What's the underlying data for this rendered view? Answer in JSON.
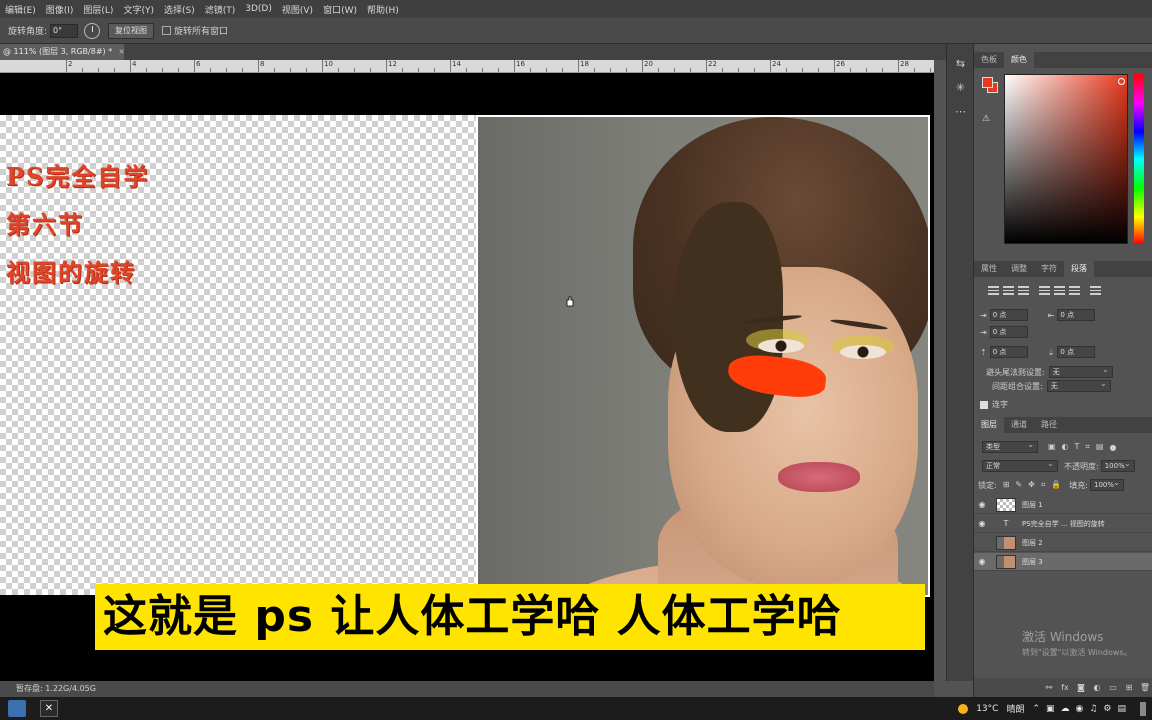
{
  "menu": [
    "编辑(E)",
    "图像(I)",
    "图层(L)",
    "文字(Y)",
    "选择(S)",
    "滤镜(T)",
    "3D(D)",
    "视图(V)",
    "窗口(W)",
    "帮助(H)"
  ],
  "options": {
    "rotate_label": "旋转角度:",
    "rotate_value": "0°",
    "reset_view": "复位视图",
    "rotate_all": "旋转所有窗口"
  },
  "doc_tab": {
    "title": "@ 111% (图层 3, RGB/8#) *",
    "close": "×"
  },
  "ruler": [
    "2",
    "4",
    "6",
    "8",
    "10",
    "12",
    "14",
    "16",
    "18",
    "20",
    "22",
    "24",
    "26",
    "28"
  ],
  "canvas": {
    "lines": [
      "PS完全自学",
      "第六节",
      "视图的旋转"
    ],
    "subtitle": "这就是 ps 让人体工学哈 人体工学哈"
  },
  "status": "暂存盘: 1.22G/4.05G",
  "color_panel": {
    "tabs": [
      "色板",
      "颜色"
    ],
    "active": 1,
    "fg": "#e8391c"
  },
  "prop_tabs": [
    "属性",
    "调整",
    "字符",
    "段落"
  ],
  "prop_active": 3,
  "paragraph": {
    "indent_left": "0 点",
    "indent_right": "0 点",
    "first_line": "0 点",
    "space_before": "0 点",
    "space_after": "0 点",
    "kinsoku_label": "避头尾法则设置:",
    "kinsoku_value": "无",
    "mojikumi_label": "间距组合设置:",
    "mojikumi_value": "无",
    "hyphen_label": "连字"
  },
  "layers_tabs": [
    "图层",
    "通道",
    "路径"
  ],
  "layers_active": 0,
  "layers": {
    "filter": "类型",
    "blend": "正常",
    "opacity_label": "不透明度:",
    "opacity": "100%",
    "lock_label": "锁定:",
    "fill_label": "填充:",
    "fill": "100%",
    "items": [
      {
        "name": "图层 1",
        "type": "pixel",
        "visible": true
      },
      {
        "name": "PS完全自学 ... 视图的旋转",
        "type": "text",
        "visible": true
      },
      {
        "name": "图层 2",
        "type": "photo",
        "visible": false
      },
      {
        "name": "图层 3",
        "type": "photo",
        "visible": true
      }
    ]
  },
  "watermark": {
    "title": "激活 Windows",
    "sub": "转到\"设置\"以激活 Windows。"
  },
  "tray": {
    "temp": "13°C",
    "weather": "晴朗"
  }
}
